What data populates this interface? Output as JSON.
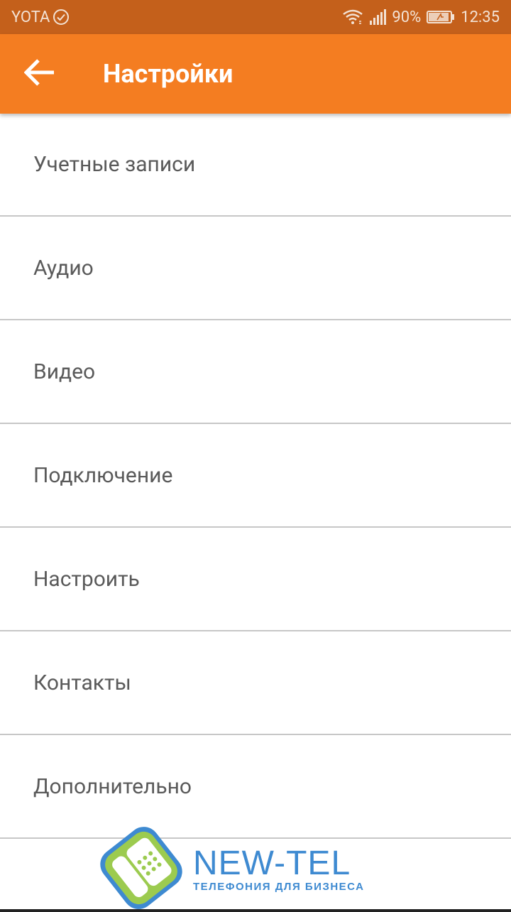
{
  "status_bar": {
    "carrier": "YOTA",
    "battery_percent": "90%",
    "time": "12:35",
    "color": "#c4601b"
  },
  "app_bar": {
    "title": "Настройки",
    "back_icon": "arrow-back-icon",
    "color": "#f47d21"
  },
  "settings": {
    "items": [
      {
        "label": "Учетные записи"
      },
      {
        "label": "Аудио"
      },
      {
        "label": "Видео"
      },
      {
        "label": "Подключение"
      },
      {
        "label": "Настроить"
      },
      {
        "label": "Контакты"
      },
      {
        "label": "Дополнительно"
      }
    ]
  },
  "footer": {
    "brand": "NEW-TEL",
    "tagline": "ТЕЛЕФОНИЯ ДЛЯ БИЗНЕСА",
    "brand_color": "#3e8ad1",
    "logo_green": "#9ccb4f"
  }
}
